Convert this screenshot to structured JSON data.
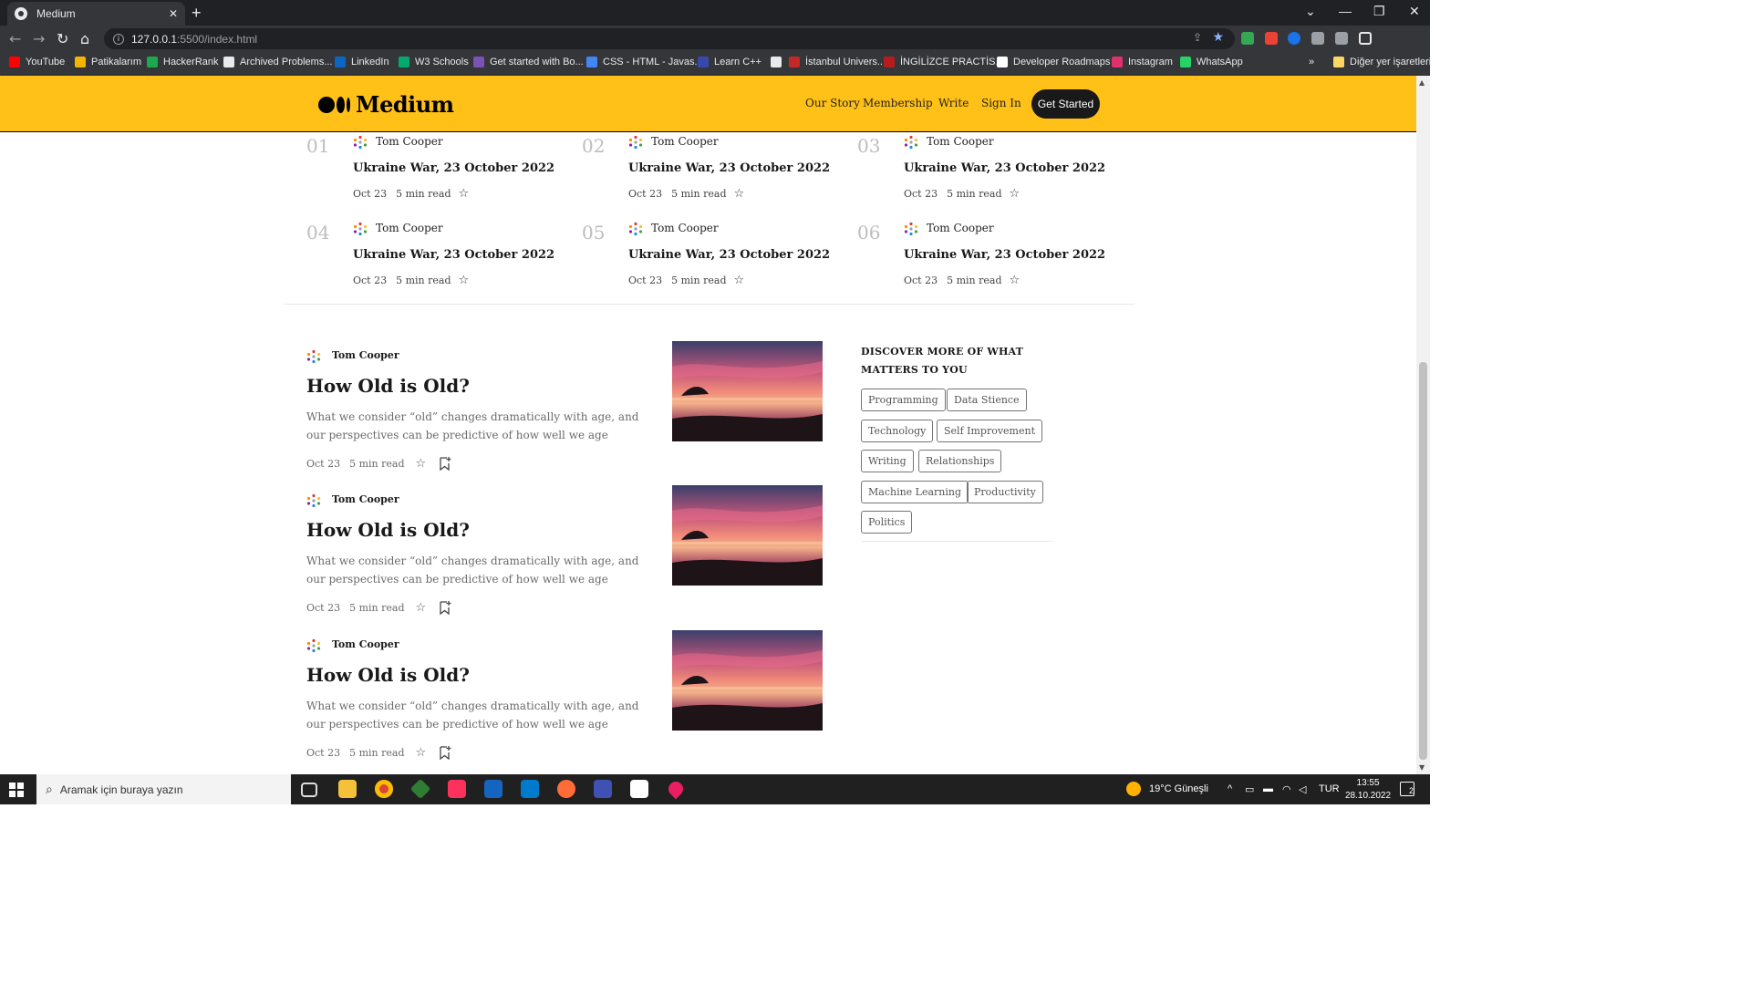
{
  "browser": {
    "tab_title": "Medium",
    "tab_close": "✕",
    "new_tab": "+",
    "url_host": "127.0.0.1",
    "url_rest": ":5500/index.html",
    "bookmarks": [
      {
        "label": "YouTube",
        "color": "#ff0000"
      },
      {
        "label": "Patikalarım",
        "color": "#f4b400"
      },
      {
        "label": "HackerRank",
        "color": "#1ba94c"
      },
      {
        "label": "Archived Problems...",
        "color": "#e8eaed"
      },
      {
        "label": "LinkedIn",
        "color": "#0a66c2"
      },
      {
        "label": "W3 Schools",
        "color": "#04aa6d"
      },
      {
        "label": "Get started with Bo...",
        "color": "#7952b3"
      },
      {
        "label": "CSS - HTML - Javas...",
        "color": "#4285f4"
      },
      {
        "label": "Learn C++",
        "color": "#3949ab"
      },
      {
        "label": "",
        "color": "#e8eaed"
      },
      {
        "label": "İstanbul Univers...",
        "color": "#c62828"
      },
      {
        "label": "İNGİLİZCE PRACTİS...",
        "color": "#b71c1c"
      },
      {
        "label": "Developer Roadmaps",
        "color": "#ffffff"
      },
      {
        "label": "Instagram",
        "color": "#e1306c"
      },
      {
        "label": "WhatsApp",
        "color": "#25d366"
      }
    ],
    "bookmarks_more": "»",
    "other_bookmarks": "Diğer yer işaretleri"
  },
  "site": {
    "logo_text": "Medium",
    "nav": [
      "Our Story",
      "Membership",
      "Write",
      "Sign In"
    ],
    "cta": "Get Started",
    "brand_color": "#ffc017"
  },
  "trending": [
    {
      "num": "01",
      "author": "Tom Cooper",
      "title": "Ukraine War, 23 October 2022",
      "date": "Oct 23",
      "read": "5 min read"
    },
    {
      "num": "02",
      "author": "Tom Cooper",
      "title": "Ukraine War, 23 October 2022",
      "date": "Oct 23",
      "read": "5 min read"
    },
    {
      "num": "03",
      "author": "Tom Cooper",
      "title": "Ukraine War, 23 October 2022",
      "date": "Oct 23",
      "read": "5 min read"
    },
    {
      "num": "04",
      "author": "Tom Cooper",
      "title": "Ukraine War, 23 October 2022",
      "date": "Oct 23",
      "read": "5 min read"
    },
    {
      "num": "05",
      "author": "Tom Cooper",
      "title": "Ukraine War, 23 October 2022",
      "date": "Oct 23",
      "read": "5 min read"
    },
    {
      "num": "06",
      "author": "Tom Cooper",
      "title": "Ukraine War, 23 October 2022",
      "date": "Oct 23",
      "read": "5 min read"
    }
  ],
  "articles": [
    {
      "author": "Tom Cooper",
      "title": "How Old is Old?",
      "description": "What we consider “old” changes dramatically with age, and our perspectives can be predictive of how well we age",
      "date": "Oct 23",
      "read": "5 min read"
    },
    {
      "author": "Tom Cooper",
      "title": "How Old is Old?",
      "description": "What we consider “old” changes dramatically with age, and our perspectives can be predictive of how well we age",
      "date": "Oct 23",
      "read": "5 min read"
    },
    {
      "author": "Tom Cooper",
      "title": "How Old is Old?",
      "description": "What we consider “old” changes dramatically with age, and our perspectives can be predictive of how well we age",
      "date": "Oct 23",
      "read": "5 min read"
    }
  ],
  "sidebar": {
    "heading": "DISCOVER MORE OF WHAT MATTERS TO YOU",
    "tags": [
      "Programming",
      "Data Stience",
      "Technology",
      "Self Improvement",
      "Writing",
      "Relationships",
      "Machine Learning",
      "Productivity",
      "Politics"
    ]
  },
  "taskbar": {
    "search_placeholder": "Aramak için buraya yazın",
    "weather": "19°C  Güneşli",
    "language": "TUR",
    "time": "13:55",
    "date": "28.10.2022",
    "notifications": "2"
  }
}
